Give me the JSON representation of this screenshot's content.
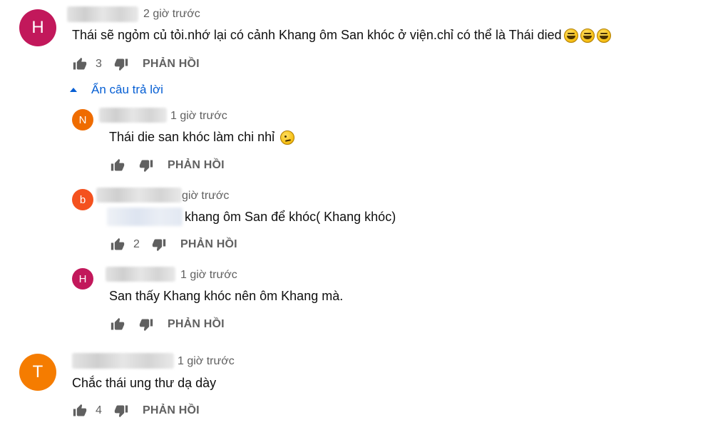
{
  "colors": {
    "avatar_h": "#c2185b",
    "avatar_n": "#ef6c00",
    "avatar_b": "#f4511e",
    "avatar_t": "#f57c00",
    "link_blue": "#065fd4",
    "meta_gray": "#606060"
  },
  "icons": {
    "like": "thumb-up-icon",
    "dislike": "thumb-down-icon",
    "expand": "caret-up-icon",
    "emoji_laugh": "rolling-on-floor-laughing-emoji",
    "emoji_think": "thinking-face-emoji"
  },
  "reply_label": "PHẢN HỒI",
  "thread1": {
    "avatar_letter": "H",
    "time": "2 giờ trước",
    "text": "Thái sẽ ngỏm củ tỏi.nhớ lại có cảnh Khang ôm San khóc ở viện.chỉ có thể là Thái died",
    "likes": "3",
    "toggle_label": "Ẩn câu trả lời"
  },
  "replies": [
    {
      "avatar_letter": "N",
      "time": "1 giờ trước",
      "text": "Thái die san khóc làm chi nhỉ",
      "likes": ""
    },
    {
      "avatar_letter": "b",
      "time": "giờ trước",
      "text": "khang ôm San để khóc( Khang khóc)",
      "likes": "2"
    },
    {
      "avatar_letter": "H",
      "time": "1 giờ trước",
      "text": "San thấy Khang khóc nên ôm Khang mà.",
      "likes": ""
    }
  ],
  "thread2": {
    "avatar_letter": "T",
    "time": "1 giờ trước",
    "text": "Chắc thái ung thư dạ dày",
    "likes": "4"
  }
}
